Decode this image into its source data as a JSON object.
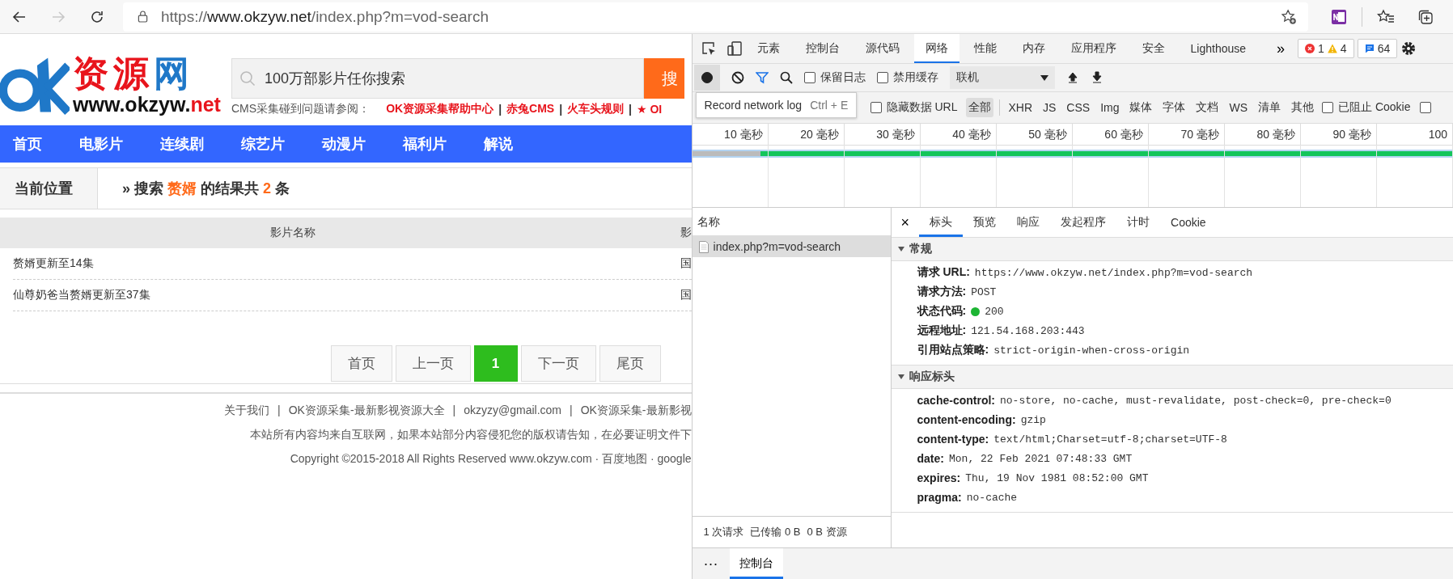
{
  "browser": {
    "url_prefix": "https://",
    "url_host": "www.okzyw.net",
    "url_path": "/index.php?m=vod-search",
    "forward_disabled": true
  },
  "site": {
    "logo": {
      "title_parts": [
        {
          "text": "资源",
          "color": "#e8141c"
        },
        {
          "text": "网",
          "color": "#1f78c8"
        }
      ],
      "domain_parts": [
        {
          "text": "www.okzyw.",
          "color": "#111111"
        },
        {
          "text": "net",
          "color": "#e8141c"
        }
      ]
    },
    "search": {
      "placeholder": "100万部影片任你搜索",
      "button": "搜"
    },
    "help": {
      "label": "CMS采集碰到问题请参阅：",
      "separator": "|",
      "links": [
        "OK资源采集帮助中心",
        "赤兔CMS",
        "火车头规则",
        "★ OI"
      ]
    },
    "nav": [
      "首页",
      "电影片",
      "连续剧",
      "综艺片",
      "动漫片",
      "福利片",
      "解说"
    ],
    "breadcrumb": {
      "label": "当前位置",
      "prefix": "» 搜索",
      "keyword": "赘婿",
      "middle": "的结果共",
      "count": "2",
      "suffix": "条"
    },
    "table": {
      "columns": [
        "影片名称",
        "影"
      ],
      "rows": [
        [
          "赘婿更新至14集",
          "国"
        ],
        [
          "仙尊奶爸当赘婿更新至37集",
          "国"
        ]
      ]
    },
    "pagination": [
      {
        "label": "首页",
        "selected": false
      },
      {
        "label": "上一页",
        "selected": false
      },
      {
        "label": "1",
        "selected": true
      },
      {
        "label": "下一页",
        "selected": false
      },
      {
        "label": "尾页",
        "selected": false
      }
    ],
    "footer": {
      "separator": "|",
      "links": [
        "关于我们",
        "OK资源采集-最新影视资源大全",
        "okzyzy@gmail.com",
        "OK资源采集-最新影视"
      ],
      "notice": "本站所有内容均来自互联网，如果本站部分内容侵犯您的版权请告知，在必要证明文件下",
      "copyright": "Copyright ©2015-2018 All Rights Reserved www.okzyw.com · 百度地图 · google"
    }
  },
  "devtools": {
    "tabs": [
      {
        "label": "元素",
        "selected": false
      },
      {
        "label": "控制台",
        "selected": false
      },
      {
        "label": "源代码",
        "selected": false
      },
      {
        "label": "网络",
        "selected": true
      },
      {
        "label": "性能",
        "selected": false
      },
      {
        "label": "内存",
        "selected": false
      },
      {
        "label": "应用程序",
        "selected": false
      },
      {
        "label": "安全",
        "selected": false
      },
      {
        "label": "Lighthouse",
        "selected": false
      }
    ],
    "more": "»",
    "errors": "1",
    "warnings": "4",
    "messages": "64",
    "toolbar": {
      "recording": true,
      "checkboxes": [
        {
          "label": "保留日志",
          "checked": false
        },
        {
          "label": "禁用缓存",
          "checked": false
        }
      ],
      "throttling": "联机"
    },
    "tooltip": {
      "text": "Record network log",
      "shortcut": "Ctrl + E"
    },
    "filters": {
      "hide_data_urls": {
        "label": "隐藏数据 URL",
        "checked": false
      },
      "types": [
        {
          "label": "全部",
          "selected": true
        },
        {
          "label": "XHR",
          "selected": false
        },
        {
          "label": "JS",
          "selected": false
        },
        {
          "label": "CSS",
          "selected": false
        },
        {
          "label": "Img",
          "selected": false
        },
        {
          "label": "媒体",
          "selected": false
        },
        {
          "label": "字体",
          "selected": false
        },
        {
          "label": "文档",
          "selected": false
        },
        {
          "label": "WS",
          "selected": false
        },
        {
          "label": "清单",
          "selected": false
        },
        {
          "label": "其他",
          "selected": false
        }
      ],
      "checkboxes": [
        {
          "label": "已阻止 Cookie",
          "checked": false
        },
        {
          "checked": false
        }
      ]
    },
    "timeline": [
      "10 毫秒",
      "20 毫秒",
      "30 毫秒",
      "40 毫秒",
      "50 毫秒",
      "60 毫秒",
      "70 毫秒",
      "80 毫秒",
      "90 毫秒",
      "100"
    ],
    "name_header": "名称",
    "requests": [
      {
        "name": "index.php?m=vod-search",
        "selected": true
      }
    ],
    "summary": [
      "1 次请求",
      "已传输 0 B",
      "0 B 资源"
    ],
    "close": "×",
    "detail_tabs": [
      {
        "label": "标头",
        "selected": true
      },
      {
        "label": "预览",
        "selected": false
      },
      {
        "label": "响应",
        "selected": false
      },
      {
        "label": "发起程序",
        "selected": false
      },
      {
        "label": "计时",
        "selected": false
      },
      {
        "label": "Cookie",
        "selected": false
      }
    ],
    "sections": [
      {
        "title": "常规",
        "expanded": true,
        "rows": [
          {
            "key": "请求 URL:",
            "value": "https://www.okzyw.net/index.php?m=vod-search"
          },
          {
            "key": "请求方法:",
            "value": "POST"
          },
          {
            "key": "状态代码:",
            "value": "200",
            "color": "#1db534"
          },
          {
            "key": "远程地址:",
            "value": "121.54.168.203:443"
          },
          {
            "key": "引用站点策略:",
            "value": "strict-origin-when-cross-origin"
          }
        ]
      },
      {
        "title": "响应标头",
        "expanded": true,
        "rows": [
          {
            "key": "cache-control:",
            "value": "no-store, no-cache, must-revalidate, post-check=0, pre-check=0"
          },
          {
            "key": "content-encoding:",
            "value": "gzip"
          },
          {
            "key": "content-type:",
            "value": "text/html;Charset=utf-8;charset=UTF-8"
          },
          {
            "key": "date:",
            "value": "Mon, 22 Feb 2021 07:48:33 GMT"
          },
          {
            "key": "expires:",
            "value": "Thu, 19 Nov 1981 08:52:00 GMT"
          },
          {
            "key": "pragma:",
            "value": "no-cache"
          }
        ]
      }
    ],
    "drawer": {
      "menu": "···",
      "tabs": [
        {
          "label": "控制台",
          "selected": true
        }
      ]
    }
  }
}
